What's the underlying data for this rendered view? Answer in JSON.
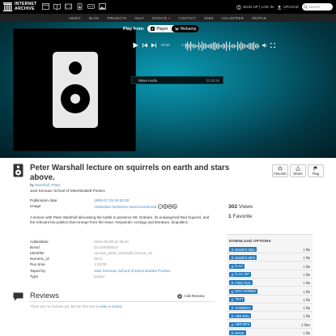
{
  "header": {
    "logo_line1": "INTERNET",
    "logo_line2": "ARCHIVE",
    "signup_label": "SIGN UP | LOG IN",
    "upload_label": "UPLOAD",
    "search_placeholder": "Search"
  },
  "nav": [
    "ABOUT",
    "BLOG",
    "PROJECTS",
    "HELP",
    "DONATE",
    "CONTACT",
    "JOBS",
    "VOLUNTEER",
    "PEOPLE"
  ],
  "player": {
    "play_from_label": "Play from:",
    "player_label": "Player",
    "webamp_label": "Webamp",
    "current_time": "00:00",
    "total_time": "1:29:46",
    "playlist_title": "Wave Audio",
    "playlist_duration": "01:29:46"
  },
  "item": {
    "title": "Peter Warshall lecture on squirrels on earth and stars above.",
    "by_label": "by",
    "creator": "Warshall, Peter",
    "collection_line": "Jack Kerouac School of Disembodied Poetics",
    "publication_date_label": "Publication date",
    "publication_date": "1990-07-15 00:00:00",
    "usage_label": "Usage",
    "usage": "Attribution-NoDerivs-NonCommercial",
    "description": "A lecture with Peter Warshall discussing the battle to preserve Mt. Graham, its endangered Red Squirrel, and the relevant bio-politics that emerge from the issue. Keywords: ecology and literature, biopolitics",
    "details": [
      {
        "key": "Addeddate",
        "value": "2004-06-08 11:36:41"
      },
      {
        "key": "Boxid",
        "value": "OL100020514"
      },
      {
        "key": "Identifier",
        "value": "naropa_peter_warshall_lecture_on"
      },
      {
        "key": "Numeric_id",
        "value": "5671"
      },
      {
        "key": "Run time",
        "value": "1:30:00"
      },
      {
        "key": "Taped by",
        "value": "Jack Kerouac School of Disembodied Poetics"
      },
      {
        "key": "Type",
        "value": "sound"
      }
    ]
  },
  "actions": {
    "favorite": "Favorite",
    "share": "Share",
    "flag": "Flag"
  },
  "stats": {
    "views_count": "302",
    "views_label": "Views",
    "favorites_count": "1",
    "favorites_label": "Favorite"
  },
  "downloads": {
    "heading": "DOWNLOAD OPTIONS",
    "options": [
      {
        "name": "64KBPS M3U",
        "count": "1 file"
      },
      {
        "name": "64KBPS MP3",
        "count": "1 file"
      },
      {
        "name": "FLAC",
        "count": "1 file"
      },
      {
        "name": "FLAC ZIP",
        "count": "1 file"
      },
      {
        "name": "ITEM TILE",
        "count": "1 file"
      },
      {
        "name": "OGG VORBIS",
        "count": "1 file"
      },
      {
        "name": "TEXT",
        "count": "1 file"
      },
      {
        "name": "TORRENT",
        "count": "1 file"
      },
      {
        "name": "VBR M3U",
        "count": "1 file"
      },
      {
        "name": "VBR MP3",
        "count": "2 files"
      },
      {
        "name": "WAVE",
        "count": "1 file"
      }
    ]
  },
  "reviews": {
    "title": "Reviews",
    "add_label": "Add Review",
    "empty_text": "There are no reviews yet. Be the first one to",
    "empty_link": "write a review"
  },
  "colors": {
    "accent": "#428bca",
    "download_badge": "#2278bd",
    "hero": "#0b9cb6"
  }
}
